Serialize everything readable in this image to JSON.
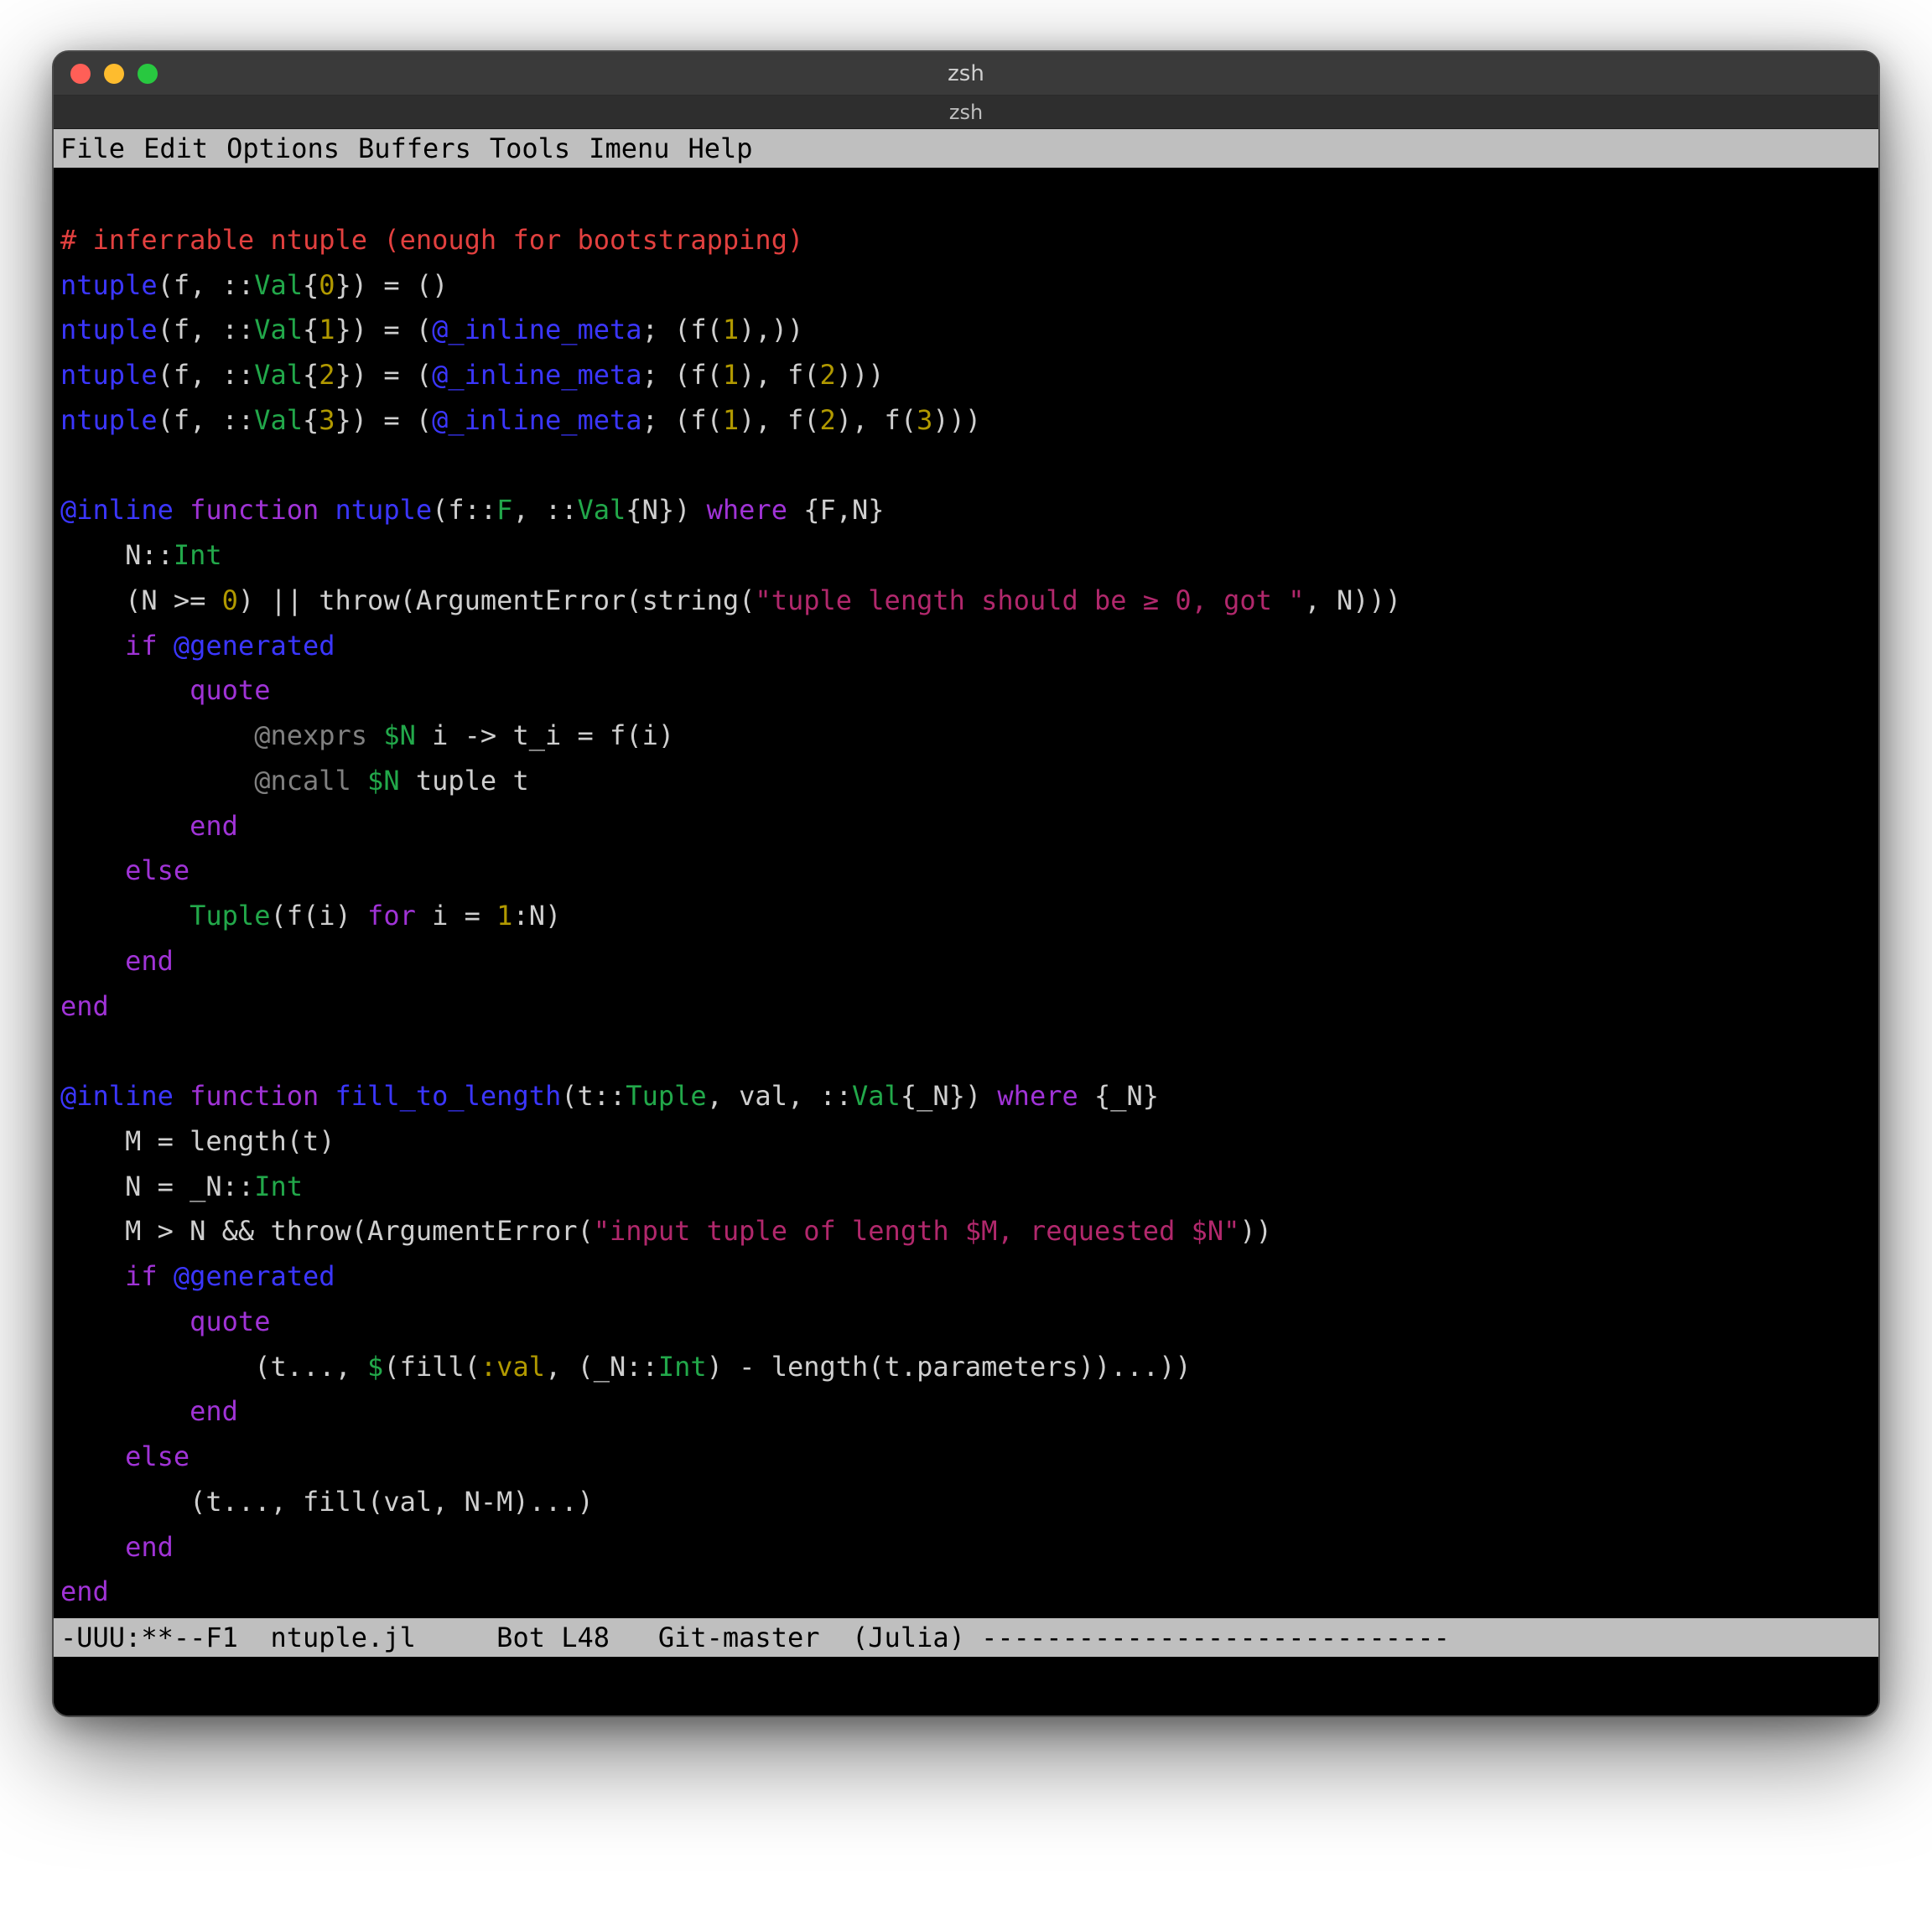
{
  "window": {
    "title": "zsh",
    "tab": "zsh"
  },
  "menu": {
    "file": "File",
    "edit": "Edit",
    "options": "Options",
    "buffers": "Buffers",
    "tools": "Tools",
    "imenu": "Imenu",
    "help": "Help"
  },
  "status": {
    "line": "-UUU:**--F1  ntuple.jl     Bot L48   Git-master  (Julia) -----------------------------"
  },
  "code": {
    "blank": "",
    "l1_comment": "# inferrable ntuple (enough for bootstrapping)",
    "l2_a": "ntuple",
    "l2_b": "(f, ::",
    "l2_c": "Val",
    "l2_d": "{",
    "l2_e": "0",
    "l2_f": "}) = ()",
    "l3_a": "ntuple",
    "l3_b": "(f, ::",
    "l3_c": "Val",
    "l3_d": "{",
    "l3_e": "1",
    "l3_f": "}) = (",
    "l3_g": "@_inline_meta",
    "l3_h": "; (f(",
    "l3_i": "1",
    "l3_j": "),))",
    "l4_a": "ntuple",
    "l4_b": "(f, ::",
    "l4_c": "Val",
    "l4_d": "{",
    "l4_e": "2",
    "l4_f": "}) = (",
    "l4_g": "@_inline_meta",
    "l4_h": "; (f(",
    "l4_i": "1",
    "l4_j": "), f(",
    "l4_k": "2",
    "l4_l": ")))",
    "l5_a": "ntuple",
    "l5_b": "(f, ::",
    "l5_c": "Val",
    "l5_d": "{",
    "l5_e": "3",
    "l5_f": "}) = (",
    "l5_g": "@_inline_meta",
    "l5_h": "; (f(",
    "l5_i": "1",
    "l5_j": "), f(",
    "l5_k": "2",
    "l5_l": "), f(",
    "l5_m": "3",
    "l5_n": ")))",
    "l7_a": "@inline",
    "l7_b": " ",
    "l7_c": "function",
    "l7_d": " ",
    "l7_e": "ntuple",
    "l7_f": "(f::",
    "l7_g": "F",
    "l7_h": ", ::",
    "l7_i": "Val",
    "l7_j": "{N}) ",
    "l7_k": "where",
    "l7_l": " {F,N}",
    "l8_a": "    N::",
    "l8_b": "Int",
    "l9_a": "    (N >= ",
    "l9_b": "0",
    "l9_c": ") || throw(ArgumentError(string(",
    "l9_d": "\"tuple length should be ≥ 0, got \"",
    "l9_e": ", N)))",
    "l10_a": "    ",
    "l10_b": "if",
    "l10_c": " ",
    "l10_d": "@generated",
    "l11_a": "        ",
    "l11_b": "quote",
    "l12_a": "            ",
    "l12_b": "@nexprs",
    "l12_c": " ",
    "l12_d": "$N",
    "l12_e": " i ",
    "l12_f": "->",
    "l12_g": " t_i = f(i)",
    "l13_a": "            ",
    "l13_b": "@ncall",
    "l13_c": " ",
    "l13_d": "$N",
    "l13_e": " tuple t",
    "l14_a": "        ",
    "l14_b": "end",
    "l15_a": "    ",
    "l15_b": "else",
    "l16_a": "        ",
    "l16_b": "Tuple",
    "l16_c": "(f(i) ",
    "l16_d": "for",
    "l16_e": " i = ",
    "l16_f": "1",
    "l16_g": ":N)",
    "l17_a": "    ",
    "l17_b": "end",
    "l18_a": "end",
    "l20_a": "@inline",
    "l20_b": " ",
    "l20_c": "function",
    "l20_d": " ",
    "l20_e": "fill_to_length",
    "l20_f": "(t::",
    "l20_g": "Tuple",
    "l20_h": ", val, ::",
    "l20_i": "Val",
    "l20_j": "{_N}) ",
    "l20_k": "where",
    "l20_l": " {_N}",
    "l21_a": "    M = length(t)",
    "l22_a": "    N = _N::",
    "l22_b": "Int",
    "l23_a": "    M > N && throw(ArgumentError(",
    "l23_b": "\"input tuple of length $M, requested $N\"",
    "l23_c": "))",
    "l24_a": "    ",
    "l24_b": "if",
    "l24_c": " ",
    "l24_d": "@generated",
    "l25_a": "        ",
    "l25_b": "quote",
    "l26_a": "            (t..., ",
    "l26_b": "$",
    "l26_c": "(fill(",
    "l26_d": ":val",
    "l26_e": ", (_N::",
    "l26_f": "Int",
    "l26_g": ") - length(t.parameters))...))",
    "l27_a": "        ",
    "l27_b": "end",
    "l28_a": "    ",
    "l28_b": "else",
    "l29_a": "        (t..., fill(val, N-M)...)",
    "l30_a": "    ",
    "l30_b": "end",
    "l31_a": "end"
  }
}
